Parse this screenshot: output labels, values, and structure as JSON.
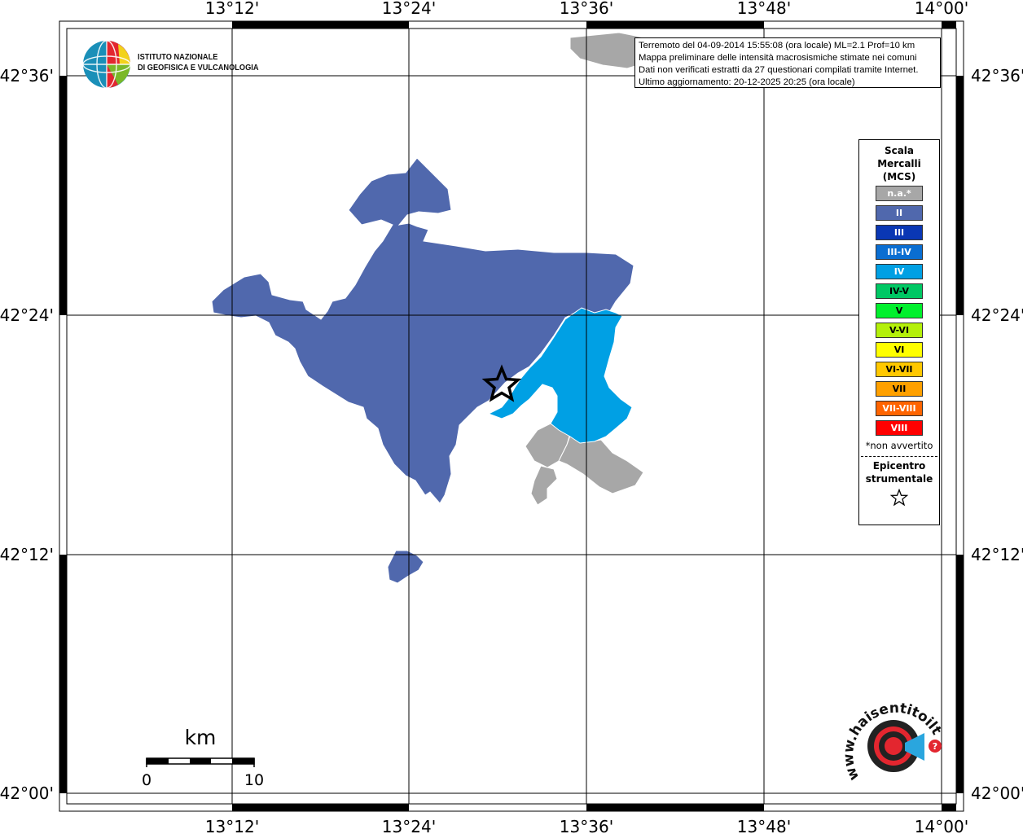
{
  "map": {
    "lon_labels": [
      "13°12'",
      "13°24'",
      "13°36'",
      "13°48'",
      "14°00'"
    ],
    "lat_labels": [
      "42°36'",
      "42°24'",
      "42°12'",
      "42°00'"
    ],
    "colors": {
      "intensity_II": "#5068ad",
      "intensity_IV": "#00a0e4",
      "not_felt": "#a7a7a7",
      "grid": "#000000"
    }
  },
  "info": {
    "line1": "Terremoto del 04-09-2014 15:55:08 (ora locale) ML=2.1 Prof=10 km",
    "line2": "Mappa preliminare delle intensità macrosismiche stimate nei comuni",
    "line3": "Dati non verificati estratti da 27 questionari compilati tramite Internet.",
    "line4": "Ultimo aggiornamento: 20-12-2025 20:25 (ora locale)"
  },
  "legend": {
    "title": "Scala\nMercalli\n(MCS)",
    "items": [
      {
        "label": "n.a.*",
        "color": "#a7a7a7",
        "text_color": "#ffffff"
      },
      {
        "label": "II",
        "color": "#5068ad",
        "text_color": "#ffffff"
      },
      {
        "label": "III",
        "color": "#0a37b4",
        "text_color": "#ffffff"
      },
      {
        "label": "III-IV",
        "color": "#0a6ed2",
        "text_color": "#ffffff"
      },
      {
        "label": "IV",
        "color": "#00a0e4",
        "text_color": "#ffffff"
      },
      {
        "label": "IV-V",
        "color": "#00c864",
        "text_color": "#000000"
      },
      {
        "label": "V",
        "color": "#00f02d",
        "text_color": "#000000"
      },
      {
        "label": "V-VI",
        "color": "#b4f00a",
        "text_color": "#000000"
      },
      {
        "label": "VI",
        "color": "#ffff00",
        "text_color": "#000000"
      },
      {
        "label": "VI-VII",
        "color": "#ffc800",
        "text_color": "#000000"
      },
      {
        "label": "VII",
        "color": "#ffa000",
        "text_color": "#000000"
      },
      {
        "label": "VII-VIII",
        "color": "#ff6400",
        "text_color": "#ffffff"
      },
      {
        "label": "VIII",
        "color": "#ff0000",
        "text_color": "#ffffff"
      }
    ],
    "note": "*non avvertito",
    "epicenter_label": "Epicentro\nstrumentale"
  },
  "logo": {
    "ingv": "ISTITUTO NAZIONALE\nDI GEOFISICA E VULCANOLOGIA",
    "hsit": "www.haisentitoilterremoto.it"
  },
  "scalebar": {
    "unit": "km",
    "start": "0",
    "end": "10"
  }
}
